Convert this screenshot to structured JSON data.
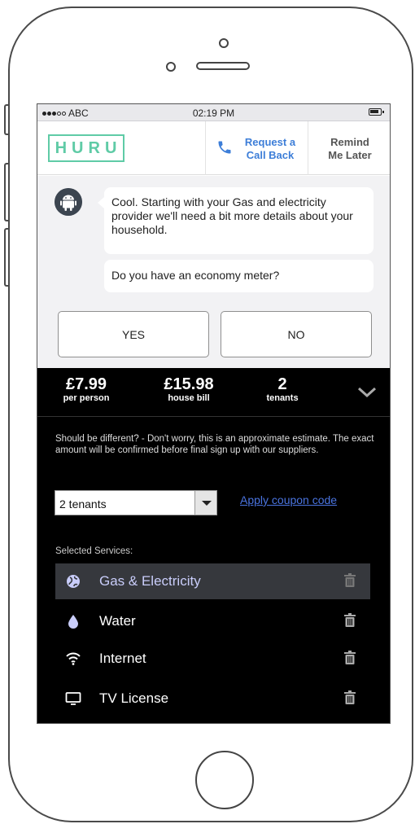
{
  "status_bar": {
    "carrier": "ABC",
    "time": "02:19 PM"
  },
  "header": {
    "logo": "HURU",
    "callback_line1": "Request a",
    "callback_line2": "Call Back",
    "remind_line1": "Remind",
    "remind_line2": "Me Later"
  },
  "chat": {
    "message": "Cool. Starting with your Gas and electricity provider we'll need a bit more details about your household.",
    "question": "Do you have an economy meter?",
    "yes_label": "YES",
    "no_label": "NO"
  },
  "summary": {
    "per_person_value": "£7.99",
    "per_person_label": "per person",
    "house_bill_value": "£15.98",
    "house_bill_label": "house bill",
    "tenants_value": "2",
    "tenants_label": "tenants"
  },
  "details": {
    "note": "Should be different? - Don't worry, this is an approximate estimate. The exact amount will be confirmed before final sign up with our suppliers.",
    "tenant_select": "2 tenants",
    "coupon_link": "Apply coupon code",
    "services_title": "Selected Services:"
  },
  "services": [
    {
      "label": "Gas & Electricity",
      "icon": "globe-icon",
      "active": true
    },
    {
      "label": "Water",
      "icon": "water-drop-icon",
      "active": false
    },
    {
      "label": "Internet",
      "icon": "wifi-icon",
      "active": false
    },
    {
      "label": "TV License",
      "icon": "tv-icon",
      "active": false
    }
  ],
  "colors": {
    "brand": "#5fcba6",
    "link": "#3d7ed8",
    "panel_bg": "#000000",
    "active_service_bg": "#36383d",
    "active_service_text": "#c9cdfa"
  }
}
